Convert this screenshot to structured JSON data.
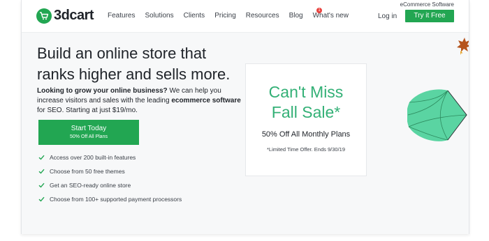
{
  "header": {
    "logo_text": "3dcart",
    "ecommerce_label": "eCommerce Software",
    "nav": [
      "Features",
      "Solutions",
      "Clients",
      "Pricing",
      "Resources",
      "Blog",
      "What's new"
    ],
    "whats_new_badge": "1",
    "login_label": "Log in",
    "try_label": "Try it Free"
  },
  "hero": {
    "headline_line1": "Build an online store that",
    "headline_line2": "ranks higher and sells more.",
    "sub_bold": "Looking to grow your online business?",
    "sub_text1": " We can help you increase visitors and sales with the leading ",
    "sub_bold2": "ecommerce software",
    "sub_text2": " for SEO. Starting at just $19/mo.",
    "cta_line1": "Start Today",
    "cta_line2": "50% Off All Plans",
    "features": [
      "Access over 200 built-in features",
      "Choose from 50 free themes",
      "Get an SEO-ready online store",
      "Choose from 100+ supported payment processors"
    ]
  },
  "promo": {
    "title_line1": "Can't Miss",
    "title_line2": "Fall Sale*",
    "subtitle": "50% Off All Monthly Plans",
    "fine_print": "*Limited Time Offer. Ends 9/30/19"
  },
  "colors": {
    "brand_green": "#22a652",
    "promo_green": "#33b076",
    "badge_red": "#e8403c"
  },
  "icons": [
    "cart-icon",
    "check-icon",
    "umbrella-icon",
    "leaf-icon",
    "star-icon"
  ]
}
